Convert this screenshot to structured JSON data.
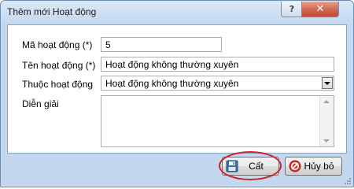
{
  "window": {
    "title": "Thêm mới Hoạt động",
    "help_label": "?",
    "close_label": "✕"
  },
  "form": {
    "code": {
      "label": "Mã hoạt động (*)",
      "value": "5"
    },
    "name": {
      "label": "Tên hoạt động (*)",
      "value": "Hoạt động không thường xuyên"
    },
    "category": {
      "label": "Thuộc hoạt động",
      "selected": "Hoạt động không thường xuyên"
    },
    "description": {
      "label": "Diễn giải",
      "value": ""
    }
  },
  "buttons": {
    "save_label": "Cất",
    "cancel_label": "Hủy bỏ"
  },
  "icons": {
    "save": "floppy-disk-icon",
    "cancel": "cancel-icon",
    "dropdown": "chevron-down-icon"
  },
  "colors": {
    "highlight_ring": "#c6262c",
    "close_button": "#c24a31",
    "accent": "#3a6ea5"
  }
}
